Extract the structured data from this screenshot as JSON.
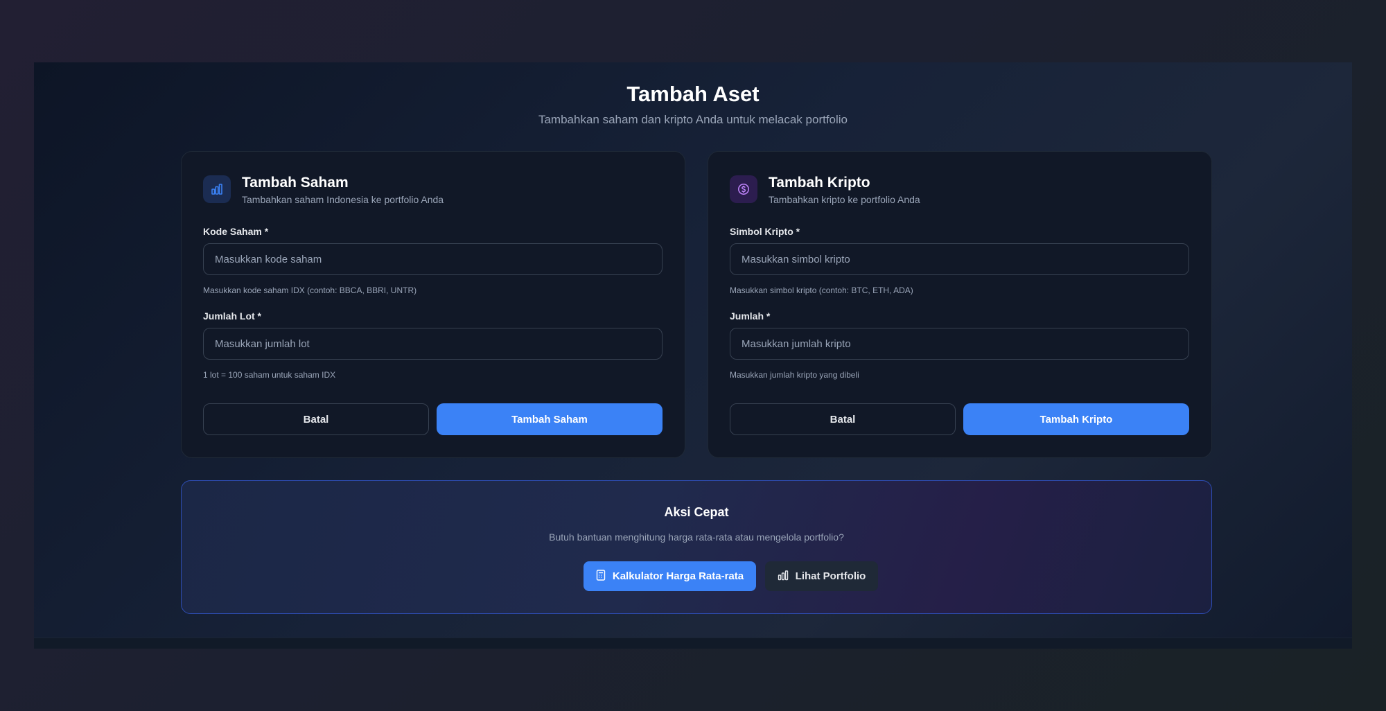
{
  "header": {
    "title": "Tambah Aset",
    "subtitle": "Tambahkan saham dan kripto Anda untuk melacak portfolio"
  },
  "stock_card": {
    "icon": "bar-chart-icon",
    "title": "Tambah Saham",
    "subtitle": "Tambahkan saham Indonesia ke portfolio Anda",
    "code_label": "Kode Saham *",
    "code_placeholder": "Masukkan kode saham",
    "code_help": "Masukkan kode saham IDX (contoh: BBCA, BBRI, UNTR)",
    "lot_label": "Jumlah Lot *",
    "lot_placeholder": "Masukkan jumlah lot",
    "lot_help": "1 lot = 100 saham untuk saham IDX",
    "cancel_label": "Batal",
    "submit_label": "Tambah Saham"
  },
  "crypto_card": {
    "icon": "dollar-circle-icon",
    "title": "Tambah Kripto",
    "subtitle": "Tambahkan kripto ke portfolio Anda",
    "symbol_label": "Simbol Kripto *",
    "symbol_placeholder": "Masukkan simbol kripto",
    "symbol_help": "Masukkan simbol kripto (contoh: BTC, ETH, ADA)",
    "amount_label": "Jumlah *",
    "amount_placeholder": "Masukkan jumlah kripto",
    "amount_help": "Masukkan jumlah kripto yang dibeli",
    "cancel_label": "Batal",
    "submit_label": "Tambah Kripto"
  },
  "quick_actions": {
    "title": "Aksi Cepat",
    "subtitle": "Butuh bantuan menghitung harga rata-rata atau mengelola portfolio?",
    "calculator_label": "Kalkulator Harga Rata-rata",
    "calculator_icon": "calculator-icon",
    "portfolio_label": "Lihat Portfolio",
    "portfolio_icon": "bar-chart-icon"
  },
  "colors": {
    "accent": "#3b82f6",
    "card_bg": "#111827",
    "border": "#374151",
    "quick_border": "#2e4db4"
  }
}
